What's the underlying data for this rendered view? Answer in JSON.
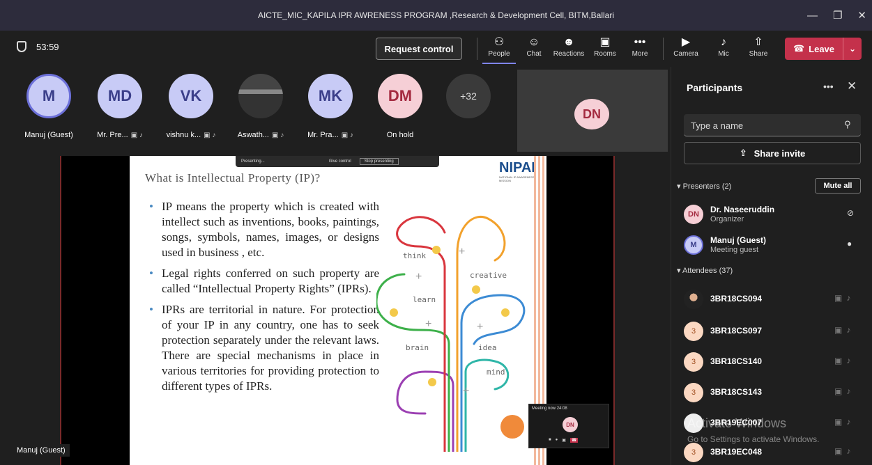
{
  "window": {
    "title": "AICTE_MIC_KAPILA IPR AWRENESS PROGRAM ,Research & Development Cell, BITM,Ballari",
    "controls": [
      "—",
      "❐",
      "✕"
    ]
  },
  "toolbar": {
    "timer": "53:59",
    "request_control": "Request control",
    "buttons": [
      {
        "label": "People",
        "icon": "people-icon",
        "glyph": "⚇"
      },
      {
        "label": "Chat",
        "icon": "chat-icon",
        "glyph": "☺"
      },
      {
        "label": "Reactions",
        "icon": "reactions-icon",
        "glyph": "☻"
      },
      {
        "label": "Rooms",
        "icon": "rooms-icon",
        "glyph": "▣"
      },
      {
        "label": "More",
        "icon": "more-icon",
        "glyph": "•••"
      },
      {
        "label": "Camera",
        "icon": "camera-off-icon",
        "glyph": "▶"
      },
      {
        "label": "Mic",
        "icon": "mic-off-icon",
        "glyph": "♪"
      },
      {
        "label": "Share",
        "icon": "share-icon",
        "glyph": "⇧"
      }
    ],
    "leave": "Leave"
  },
  "participants_strip": [
    {
      "initials": "M",
      "label": "Manuj (Guest)"
    },
    {
      "initials": "MD",
      "label": "Mr. Pre..."
    },
    {
      "initials": "VK",
      "label": "vishnu k..."
    },
    {
      "initials": "",
      "label": "Aswath..."
    },
    {
      "initials": "MK",
      "label": "Mr. Pra..."
    },
    {
      "initials": "DM",
      "label": "On hold"
    },
    {
      "initials": "+32",
      "label": ""
    }
  ],
  "speaker_tile": {
    "initials": "DN"
  },
  "presenting_bar": {
    "status": "Presenting...",
    "give_control": "Give control",
    "stop": "Stop presenting"
  },
  "slide": {
    "title": "What is Intellectual Property (IP)?",
    "logo": "NIPAM",
    "logo_sub": "NATIONAL IP AWARENESS MISSION",
    "bullets": [
      "IP means the property which is created with intellect such as inventions, books, paintings, songs, symbols, names, images, or designs used in business , etc.",
      "Legal rights conferred on such property are called “Intellectual Property Rights” (IPRs).",
      "IPRs are territorial in nature. For protection of your IP in any country, one has to seek protection separately under the relevant laws. There are special mechanisms in place in various territories for providing protection to different types of IPRs."
    ],
    "brain_words": [
      "think",
      "creative",
      "learn",
      "brain",
      "idea",
      "mind"
    ]
  },
  "mini_window": {
    "title": "Meeting now",
    "time": "24:08",
    "initials": "DN"
  },
  "self_label": "Manuj (Guest)",
  "panel": {
    "title": "Participants",
    "search_placeholder": "Type a name",
    "share_invite": "Share invite",
    "presenters_header": "Presenters (2)",
    "mute_all": "Mute all",
    "presenters": [
      {
        "initials": "DN",
        "name": "Dr. Naseeruddin",
        "role": "Organizer"
      },
      {
        "initials": "M",
        "name": "Manuj (Guest)",
        "role": "Meeting guest"
      }
    ],
    "attendees_header": "Attendees (37)",
    "attendees": [
      {
        "initials": "",
        "name": "3BR18CS094"
      },
      {
        "initials": "3",
        "name": "3BR18CS097"
      },
      {
        "initials": "3",
        "name": "3BR18CS140"
      },
      {
        "initials": "3",
        "name": "3BR18CS143"
      },
      {
        "initials": "",
        "name": "3BR19EC007"
      },
      {
        "initials": "3",
        "name": "3BR19EC048"
      }
    ]
  },
  "watermark": {
    "line1": "Activate Windows",
    "line2": "Go to Settings to activate Windows."
  }
}
